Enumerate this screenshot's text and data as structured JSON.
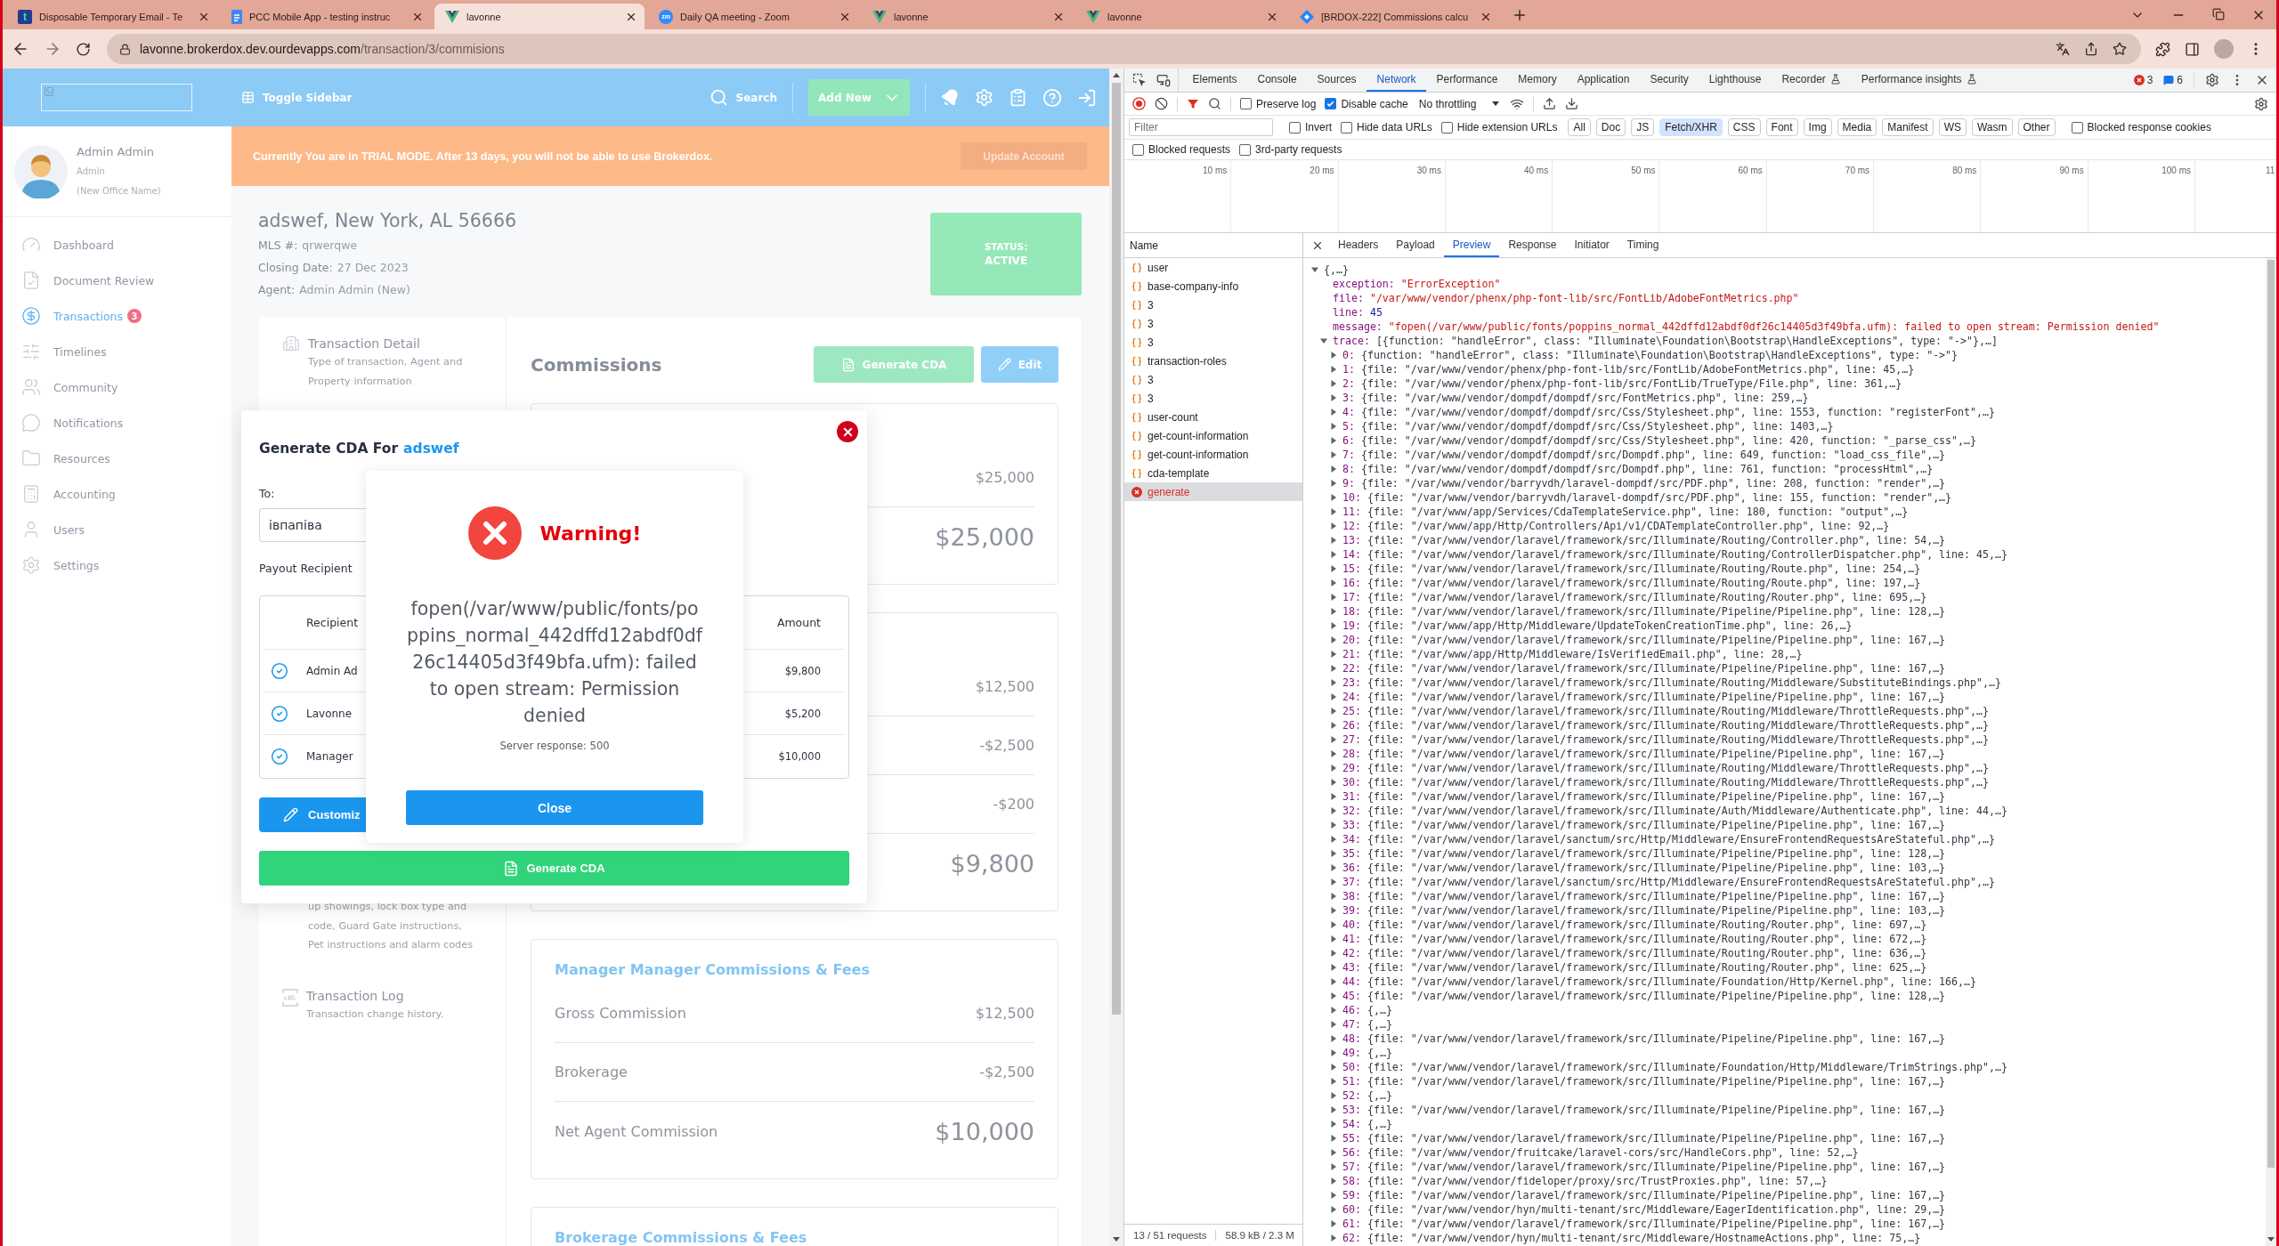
{
  "browser": {
    "tabs": [
      {
        "title": "Disposable Temporary Email - Te",
        "selected": false,
        "favicon_text": "t"
      },
      {
        "title": "PCC Mobile App - testing instruc",
        "selected": false
      },
      {
        "title": "lavonne",
        "selected": true
      },
      {
        "title": "Daily QA meeting - Zoom",
        "selected": false,
        "favicon_text": "zm"
      },
      {
        "title": "lavonne",
        "selected": false
      },
      {
        "title": "lavonne",
        "selected": false
      },
      {
        "title": "[BRDOX-222] Commissions calcu",
        "selected": false
      }
    ],
    "url_host": "lavonne.brokerdox.dev.ourdevapps.com",
    "url_path": "/transaction/3/commisions"
  },
  "app": {
    "header": {
      "toggle_label": "Toggle Sidebar",
      "search_label": "Search",
      "add_new_label": "Add New"
    },
    "sidebar": {
      "user_name": "Admin Admin",
      "user_role": "Admin",
      "user_office": "(New Office Name)",
      "items": [
        {
          "label": "Dashboard",
          "selected": false
        },
        {
          "label": "Document Review",
          "selected": false
        },
        {
          "label": "Transactions",
          "selected": true,
          "badge": "3"
        },
        {
          "label": "Timelines",
          "selected": false
        },
        {
          "label": "Community",
          "selected": false
        },
        {
          "label": "Notifications",
          "selected": false
        },
        {
          "label": "Resources",
          "selected": false
        },
        {
          "label": "Accounting",
          "selected": false
        },
        {
          "label": "Users",
          "selected": false
        },
        {
          "label": "Settings",
          "selected": false
        }
      ]
    },
    "trial_banner": {
      "text": "Currently You are in TRIAL MODE. After 13 days, you will not be able to use Brokerdox.",
      "button": "Update Account"
    },
    "property": {
      "address": "adswef, New York, AL 56666",
      "fields": [
        {
          "label": "MLS #:",
          "value": "qrwerqwe"
        },
        {
          "label": "Closing Date:",
          "value": "27 Dec 2023"
        },
        {
          "label": "Agent:",
          "value": "Admin Admin (New)"
        }
      ]
    },
    "status": {
      "label": "STATUS:",
      "value": "ACTIVE"
    },
    "detail_sections": [
      {
        "title": "Transaction Detail",
        "description": "Type of transaction, Agent and Property information"
      },
      {
        "description": "up showings, lock box type and code, Guard Gate instructions, Pet instructions and alarm codes"
      },
      {
        "title": "Transaction Log",
        "description": "Transaction change history."
      }
    ],
    "commissions": {
      "title": "Commissions",
      "actions": [
        {
          "label": "Generate CDA",
          "kind": "generate"
        },
        {
          "label": "Edit",
          "kind": "edit"
        }
      ],
      "sections": [
        {
          "rows": [
            {
              "value": "$25,000",
              "kind": "line"
            },
            {
              "value": "$25,000",
              "kind": "total"
            }
          ]
        },
        {
          "rows": [
            {
              "value": "$12,500",
              "kind": "line"
            },
            {
              "value": "-$2,500",
              "kind": "line"
            },
            {
              "value": "-$200",
              "kind": "line"
            },
            {
              "value": "$9,800",
              "kind": "total"
            }
          ]
        },
        {
          "title": "Manager Manager Commissions & Fees",
          "rows": [
            {
              "label": "Gross Commission",
              "value": "$12,500",
              "kind": "line"
            },
            {
              "label": "Brokerage",
              "value": "-$2,500",
              "kind": "line"
            },
            {
              "label": "Net Agent Commission",
              "value": "$10,000",
              "kind": "total"
            }
          ]
        },
        {
          "title": "Brokerage Commissions & Fees"
        }
      ]
    }
  },
  "cda_modal": {
    "title": "Generate CDA For",
    "title_name": "adswef",
    "to_label": "To:",
    "to_value": "івпапіва",
    "recipients_label": "Payout Recipient",
    "columns": [
      "Recipient",
      "Amount"
    ],
    "rows": [
      {
        "name": "Admin Ad",
        "amount": "$9,800",
        "checked": true
      },
      {
        "name": "Lavonne",
        "amount": "$5,200",
        "checked": true
      },
      {
        "name": "Manager",
        "amount": "$10,000",
        "checked": true
      }
    ],
    "customize_label": "Customiz",
    "generate_label": "Generate CDA"
  },
  "warning": {
    "title": "Warning!",
    "message": "fopen(/var/www/public/fonts/poppins_normal_442dffd12abdf0df26c14405d3f49bfa.ufm): failed to open stream: Permission denied",
    "detail": "Server response: 500",
    "button": "Close"
  },
  "devtools": {
    "tabs": [
      {
        "label": "Elements",
        "selected": false,
        "experimental": false
      },
      {
        "label": "Console",
        "selected": false,
        "experimental": false
      },
      {
        "label": "Sources",
        "selected": false,
        "experimental": false
      },
      {
        "label": "Network",
        "selected": true,
        "experimental": false
      },
      {
        "label": "Performance",
        "selected": false,
        "experimental": false
      },
      {
        "label": "Memory",
        "selected": false,
        "experimental": false
      },
      {
        "label": "Application",
        "selected": false,
        "experimental": false
      },
      {
        "label": "Security",
        "selected": false,
        "experimental": false
      },
      {
        "label": "Lighthouse",
        "selected": false,
        "experimental": false
      },
      {
        "label": "Recorder",
        "selected": false,
        "experimental": true
      },
      {
        "label": "Performance insights",
        "selected": false,
        "experimental": true
      }
    ],
    "error_count": "3",
    "message_count": "6",
    "recording": true,
    "toolbar_options": [
      {
        "label": "Preserve log",
        "checked": false
      },
      {
        "label": "Disable cache",
        "checked": true
      }
    ],
    "throttling": "No throttling",
    "filter_placeholder": "Filter",
    "filter_options": [
      {
        "label": "Invert",
        "checked": false
      },
      {
        "label": "Hide data URLs",
        "checked": false
      },
      {
        "label": "Hide extension URLs",
        "checked": false
      }
    ],
    "type_filters": [
      {
        "label": "All",
        "selected": false
      },
      {
        "label": "Doc",
        "selected": false
      },
      {
        "label": "JS",
        "selected": false
      },
      {
        "label": "Fetch/XHR",
        "selected": true
      },
      {
        "label": "CSS",
        "selected": false
      },
      {
        "label": "Font",
        "selected": false
      },
      {
        "label": "Img",
        "selected": false
      },
      {
        "label": "Media",
        "selected": false
      },
      {
        "label": "Manifest",
        "selected": false
      },
      {
        "label": "WS",
        "selected": false
      },
      {
        "label": "Wasm",
        "selected": false
      },
      {
        "label": "Other",
        "selected": false
      }
    ],
    "cookie_option": {
      "label": "Blocked response cookies",
      "checked": false
    },
    "extra_options": [
      {
        "label": "Blocked requests",
        "checked": false
      },
      {
        "label": "3rd-party requests",
        "checked": false
      }
    ],
    "timeline_ticks": [
      "10 ms",
      "20 ms",
      "30 ms",
      "40 ms",
      "50 ms",
      "60 ms",
      "70 ms",
      "80 ms",
      "90 ms",
      "100 ms",
      "11"
    ],
    "name_header": "Name",
    "requests": [
      {
        "name": "user",
        "selected": false,
        "failed": false
      },
      {
        "name": "base-company-info",
        "selected": false,
        "failed": false
      },
      {
        "name": "3",
        "selected": false,
        "failed": false
      },
      {
        "name": "3",
        "selected": false,
        "failed": false
      },
      {
        "name": "3",
        "selected": false,
        "failed": false
      },
      {
        "name": "transaction-roles",
        "selected": false,
        "failed": false
      },
      {
        "name": "3",
        "selected": false,
        "failed": false
      },
      {
        "name": "3",
        "selected": false,
        "failed": false
      },
      {
        "name": "user-count",
        "selected": false,
        "failed": false
      },
      {
        "name": "get-count-information",
        "selected": false,
        "failed": false
      },
      {
        "name": "get-count-information",
        "selected": false,
        "failed": false
      },
      {
        "name": "cda-template",
        "selected": false,
        "failed": false
      },
      {
        "name": "generate",
        "selected": true,
        "failed": true
      }
    ],
    "summary": [
      "13 / 51 requests",
      "58.9 kB / 2.3 M"
    ],
    "detail_tabs": [
      {
        "label": "Headers",
        "selected": false
      },
      {
        "label": "Payload",
        "selected": false
      },
      {
        "label": "Preview",
        "selected": true
      },
      {
        "label": "Response",
        "selected": false
      },
      {
        "label": "Initiator",
        "selected": false
      },
      {
        "label": "Timing",
        "selected": false
      }
    ],
    "preview": {
      "root": "{,…}",
      "root_expanded": true,
      "properties": [
        {
          "key": "exception:",
          "value": "\"ErrorException\"",
          "kind": "string"
        },
        {
          "key": "file:",
          "value": "\"/var/www/vendor/phenx/php-font-lib/src/FontLib/AdobeFontMetrics.php\"",
          "kind": "string"
        },
        {
          "key": "line:",
          "value": "45",
          "kind": "number"
        },
        {
          "key": "message:",
          "value": "\"fopen(/var/www/public/fonts/poppins_normal_442dffd12abdf0df26c14405d3f49bfa.ufm): failed to open stream: Permission denied\"",
          "kind": "string"
        }
      ],
      "trace": {
        "key": "trace:",
        "value": "[{function: \"handleError\", class: \"Illuminate\\Foundation\\Bootstrap\\HandleExceptions\", type: \"->\"},…]",
        "expanded": true,
        "items": [
          {
            "key": "0:",
            "value": "{function: \"handleError\", class: \"Illuminate\\Foundation\\Bootstrap\\HandleExceptions\", type: \"->\"}",
            "expanded": false
          },
          {
            "key": "1:",
            "value": "{file: \"/var/www/vendor/phenx/php-font-lib/src/FontLib/AdobeFontMetrics.php\", line: 45,…}",
            "expanded": false
          },
          {
            "key": "2:",
            "value": "{file: \"/var/www/vendor/phenx/php-font-lib/src/FontLib/TrueType/File.php\", line: 361,…}",
            "expanded": false
          },
          {
            "key": "3:",
            "value": "{file: \"/var/www/vendor/dompdf/dompdf/src/FontMetrics.php\", line: 259,…}",
            "expanded": false
          },
          {
            "key": "4:",
            "value": "{file: \"/var/www/vendor/dompdf/dompdf/src/Css/Stylesheet.php\", line: 1553, function: \"registerFont\",…}",
            "expanded": false
          },
          {
            "key": "5:",
            "value": "{file: \"/var/www/vendor/dompdf/dompdf/src/Css/Stylesheet.php\", line: 1403,…}",
            "expanded": false
          },
          {
            "key": "6:",
            "value": "{file: \"/var/www/vendor/dompdf/dompdf/src/Css/Stylesheet.php\", line: 420, function: \"_parse_css\",…}",
            "expanded": false
          },
          {
            "key": "7:",
            "value": "{file: \"/var/www/vendor/dompdf/dompdf/src/Dompdf.php\", line: 649, function: \"load_css_file\",…}",
            "expanded": false
          },
          {
            "key": "8:",
            "value": "{file: \"/var/www/vendor/dompdf/dompdf/src/Dompdf.php\", line: 761, function: \"processHtml\",…}",
            "expanded": false
          },
          {
            "key": "9:",
            "value": "{file: \"/var/www/vendor/barryvdh/laravel-dompdf/src/PDF.php\", line: 208, function: \"render\",…}",
            "expanded": false
          },
          {
            "key": "10:",
            "value": "{file: \"/var/www/vendor/barryvdh/laravel-dompdf/src/PDF.php\", line: 155, function: \"render\",…}",
            "expanded": false
          },
          {
            "key": "11:",
            "value": "{file: \"/var/www/app/Services/CdaTemplateService.php\", line: 180, function: \"output\",…}",
            "expanded": false
          },
          {
            "key": "12:",
            "value": "{file: \"/var/www/app/Http/Controllers/Api/v1/CDATemplateController.php\", line: 92,…}",
            "expanded": false
          },
          {
            "key": "13:",
            "value": "{file: \"/var/www/vendor/laravel/framework/src/Illuminate/Routing/Controller.php\", line: 54,…}",
            "expanded": false
          },
          {
            "key": "14:",
            "value": "{file: \"/var/www/vendor/laravel/framework/src/Illuminate/Routing/ControllerDispatcher.php\", line: 45,…}",
            "expanded": false
          },
          {
            "key": "15:",
            "value": "{file: \"/var/www/vendor/laravel/framework/src/Illuminate/Routing/Route.php\", line: 254,…}",
            "expanded": false
          },
          {
            "key": "16:",
            "value": "{file: \"/var/www/vendor/laravel/framework/src/Illuminate/Routing/Route.php\", line: 197,…}",
            "expanded": false
          },
          {
            "key": "17:",
            "value": "{file: \"/var/www/vendor/laravel/framework/src/Illuminate/Routing/Router.php\", line: 695,…}",
            "expanded": false
          },
          {
            "key": "18:",
            "value": "{file: \"/var/www/vendor/laravel/framework/src/Illuminate/Pipeline/Pipeline.php\", line: 128,…}",
            "expanded": false
          },
          {
            "key": "19:",
            "value": "{file: \"/var/www/app/Http/Middleware/UpdateTokenCreationTime.php\", line: 26,…}",
            "expanded": false
          },
          {
            "key": "20:",
            "value": "{file: \"/var/www/vendor/laravel/framework/src/Illuminate/Pipeline/Pipeline.php\", line: 167,…}",
            "expanded": false
          },
          {
            "key": "21:",
            "value": "{file: \"/var/www/app/Http/Middleware/IsVerifiedEmail.php\", line: 28,…}",
            "expanded": false
          },
          {
            "key": "22:",
            "value": "{file: \"/var/www/vendor/laravel/framework/src/Illuminate/Pipeline/Pipeline.php\", line: 167,…}",
            "expanded": false
          },
          {
            "key": "23:",
            "value": "{file: \"/var/www/vendor/laravel/framework/src/Illuminate/Routing/Middleware/SubstituteBindings.php\",…}",
            "expanded": false
          },
          {
            "key": "24:",
            "value": "{file: \"/var/www/vendor/laravel/framework/src/Illuminate/Pipeline/Pipeline.php\", line: 167,…}",
            "expanded": false
          },
          {
            "key": "25:",
            "value": "{file: \"/var/www/vendor/laravel/framework/src/Illuminate/Routing/Middleware/ThrottleRequests.php\",…}",
            "expanded": false
          },
          {
            "key": "26:",
            "value": "{file: \"/var/www/vendor/laravel/framework/src/Illuminate/Routing/Middleware/ThrottleRequests.php\",…}",
            "expanded": false
          },
          {
            "key": "27:",
            "value": "{file: \"/var/www/vendor/laravel/framework/src/Illuminate/Routing/Middleware/ThrottleRequests.php\",…}",
            "expanded": false
          },
          {
            "key": "28:",
            "value": "{file: \"/var/www/vendor/laravel/framework/src/Illuminate/Pipeline/Pipeline.php\", line: 167,…}",
            "expanded": false
          },
          {
            "key": "29:",
            "value": "{file: \"/var/www/vendor/laravel/framework/src/Illuminate/Routing/Middleware/ThrottleRequests.php\",…}",
            "expanded": false
          },
          {
            "key": "30:",
            "value": "{file: \"/var/www/vendor/laravel/framework/src/Illuminate/Routing/Middleware/ThrottleRequests.php\",…}",
            "expanded": false
          },
          {
            "key": "31:",
            "value": "{file: \"/var/www/vendor/laravel/framework/src/Illuminate/Pipeline/Pipeline.php\", line: 167,…}",
            "expanded": false
          },
          {
            "key": "32:",
            "value": "{file: \"/var/www/vendor/laravel/framework/src/Illuminate/Auth/Middleware/Authenticate.php\", line: 44,…}",
            "expanded": false
          },
          {
            "key": "33:",
            "value": "{file: \"/var/www/vendor/laravel/framework/src/Illuminate/Pipeline/Pipeline.php\", line: 167,…}",
            "expanded": false
          },
          {
            "key": "34:",
            "value": "{file: \"/var/www/vendor/laravel/sanctum/src/Http/Middleware/EnsureFrontendRequestsAreStateful.php\",…}",
            "expanded": false
          },
          {
            "key": "35:",
            "value": "{file: \"/var/www/vendor/laravel/framework/src/Illuminate/Pipeline/Pipeline.php\", line: 128,…}",
            "expanded": false
          },
          {
            "key": "36:",
            "value": "{file: \"/var/www/vendor/laravel/framework/src/Illuminate/Pipeline/Pipeline.php\", line: 103,…}",
            "expanded": false
          },
          {
            "key": "37:",
            "value": "{file: \"/var/www/vendor/laravel/sanctum/src/Http/Middleware/EnsureFrontendRequestsAreStateful.php\",…}",
            "expanded": false
          },
          {
            "key": "38:",
            "value": "{file: \"/var/www/vendor/laravel/framework/src/Illuminate/Pipeline/Pipeline.php\", line: 167,…}",
            "expanded": false
          },
          {
            "key": "39:",
            "value": "{file: \"/var/www/vendor/laravel/framework/src/Illuminate/Pipeline/Pipeline.php\", line: 103,…}",
            "expanded": false
          },
          {
            "key": "40:",
            "value": "{file: \"/var/www/vendor/laravel/framework/src/Illuminate/Routing/Router.php\", line: 697,…}",
            "expanded": false
          },
          {
            "key": "41:",
            "value": "{file: \"/var/www/vendor/laravel/framework/src/Illuminate/Routing/Router.php\", line: 672,…}",
            "expanded": false
          },
          {
            "key": "42:",
            "value": "{file: \"/var/www/vendor/laravel/framework/src/Illuminate/Routing/Router.php\", line: 636,…}",
            "expanded": false
          },
          {
            "key": "43:",
            "value": "{file: \"/var/www/vendor/laravel/framework/src/Illuminate/Routing/Router.php\", line: 625,…}",
            "expanded": false
          },
          {
            "key": "44:",
            "value": "{file: \"/var/www/vendor/laravel/framework/src/Illuminate/Foundation/Http/Kernel.php\", line: 166,…}",
            "expanded": false
          },
          {
            "key": "45:",
            "value": "{file: \"/var/www/vendor/laravel/framework/src/Illuminate/Pipeline/Pipeline.php\", line: 128,…}",
            "expanded": false
          },
          {
            "key": "46:",
            "value": "{,…}",
            "expanded": false
          },
          {
            "key": "47:",
            "value": "{,…}",
            "expanded": false
          },
          {
            "key": "48:",
            "value": "{file: \"/var/www/vendor/laravel/framework/src/Illuminate/Pipeline/Pipeline.php\", line: 167,…}",
            "expanded": false
          },
          {
            "key": "49:",
            "value": "{,…}",
            "expanded": false
          },
          {
            "key": "50:",
            "value": "{file: \"/var/www/vendor/laravel/framework/src/Illuminate/Foundation/Http/Middleware/TrimStrings.php\",…}",
            "expanded": false
          },
          {
            "key": "51:",
            "value": "{file: \"/var/www/vendor/laravel/framework/src/Illuminate/Pipeline/Pipeline.php\", line: 167,…}",
            "expanded": false
          },
          {
            "key": "52:",
            "value": "{,…}",
            "expanded": false
          },
          {
            "key": "53:",
            "value": "{file: \"/var/www/vendor/laravel/framework/src/Illuminate/Pipeline/Pipeline.php\", line: 167,…}",
            "expanded": false
          },
          {
            "key": "54:",
            "value": "{,…}",
            "expanded": false
          },
          {
            "key": "55:",
            "value": "{file: \"/var/www/vendor/laravel/framework/src/Illuminate/Pipeline/Pipeline.php\", line: 167,…}",
            "expanded": false
          },
          {
            "key": "56:",
            "value": "{file: \"/var/www/vendor/fruitcake/laravel-cors/src/HandleCors.php\", line: 52,…}",
            "expanded": false
          },
          {
            "key": "57:",
            "value": "{file: \"/var/www/vendor/laravel/framework/src/Illuminate/Pipeline/Pipeline.php\", line: 167,…}",
            "expanded": false
          },
          {
            "key": "58:",
            "value": "{file: \"/var/www/vendor/fideloper/proxy/src/TrustProxies.php\", line: 57,…}",
            "expanded": false
          },
          {
            "key": "59:",
            "value": "{file: \"/var/www/vendor/laravel/framework/src/Illuminate/Pipeline/Pipeline.php\", line: 167,…}",
            "expanded": false
          },
          {
            "key": "60:",
            "value": "{file: \"/var/www/vendor/hyn/multi-tenant/src/Middleware/EagerIdentification.php\", line: 29,…}",
            "expanded": false
          },
          {
            "key": "61:",
            "value": "{file: \"/var/www/vendor/laravel/framework/src/Illuminate/Pipeline/Pipeline.php\", line: 167,…}",
            "expanded": false
          },
          {
            "key": "62:",
            "value": "{file: \"/var/www/vendor/hyn/multi-tenant/src/Middleware/HostnameActions.php\", line: 75,…}",
            "expanded": false
          }
        ]
      }
    }
  }
}
